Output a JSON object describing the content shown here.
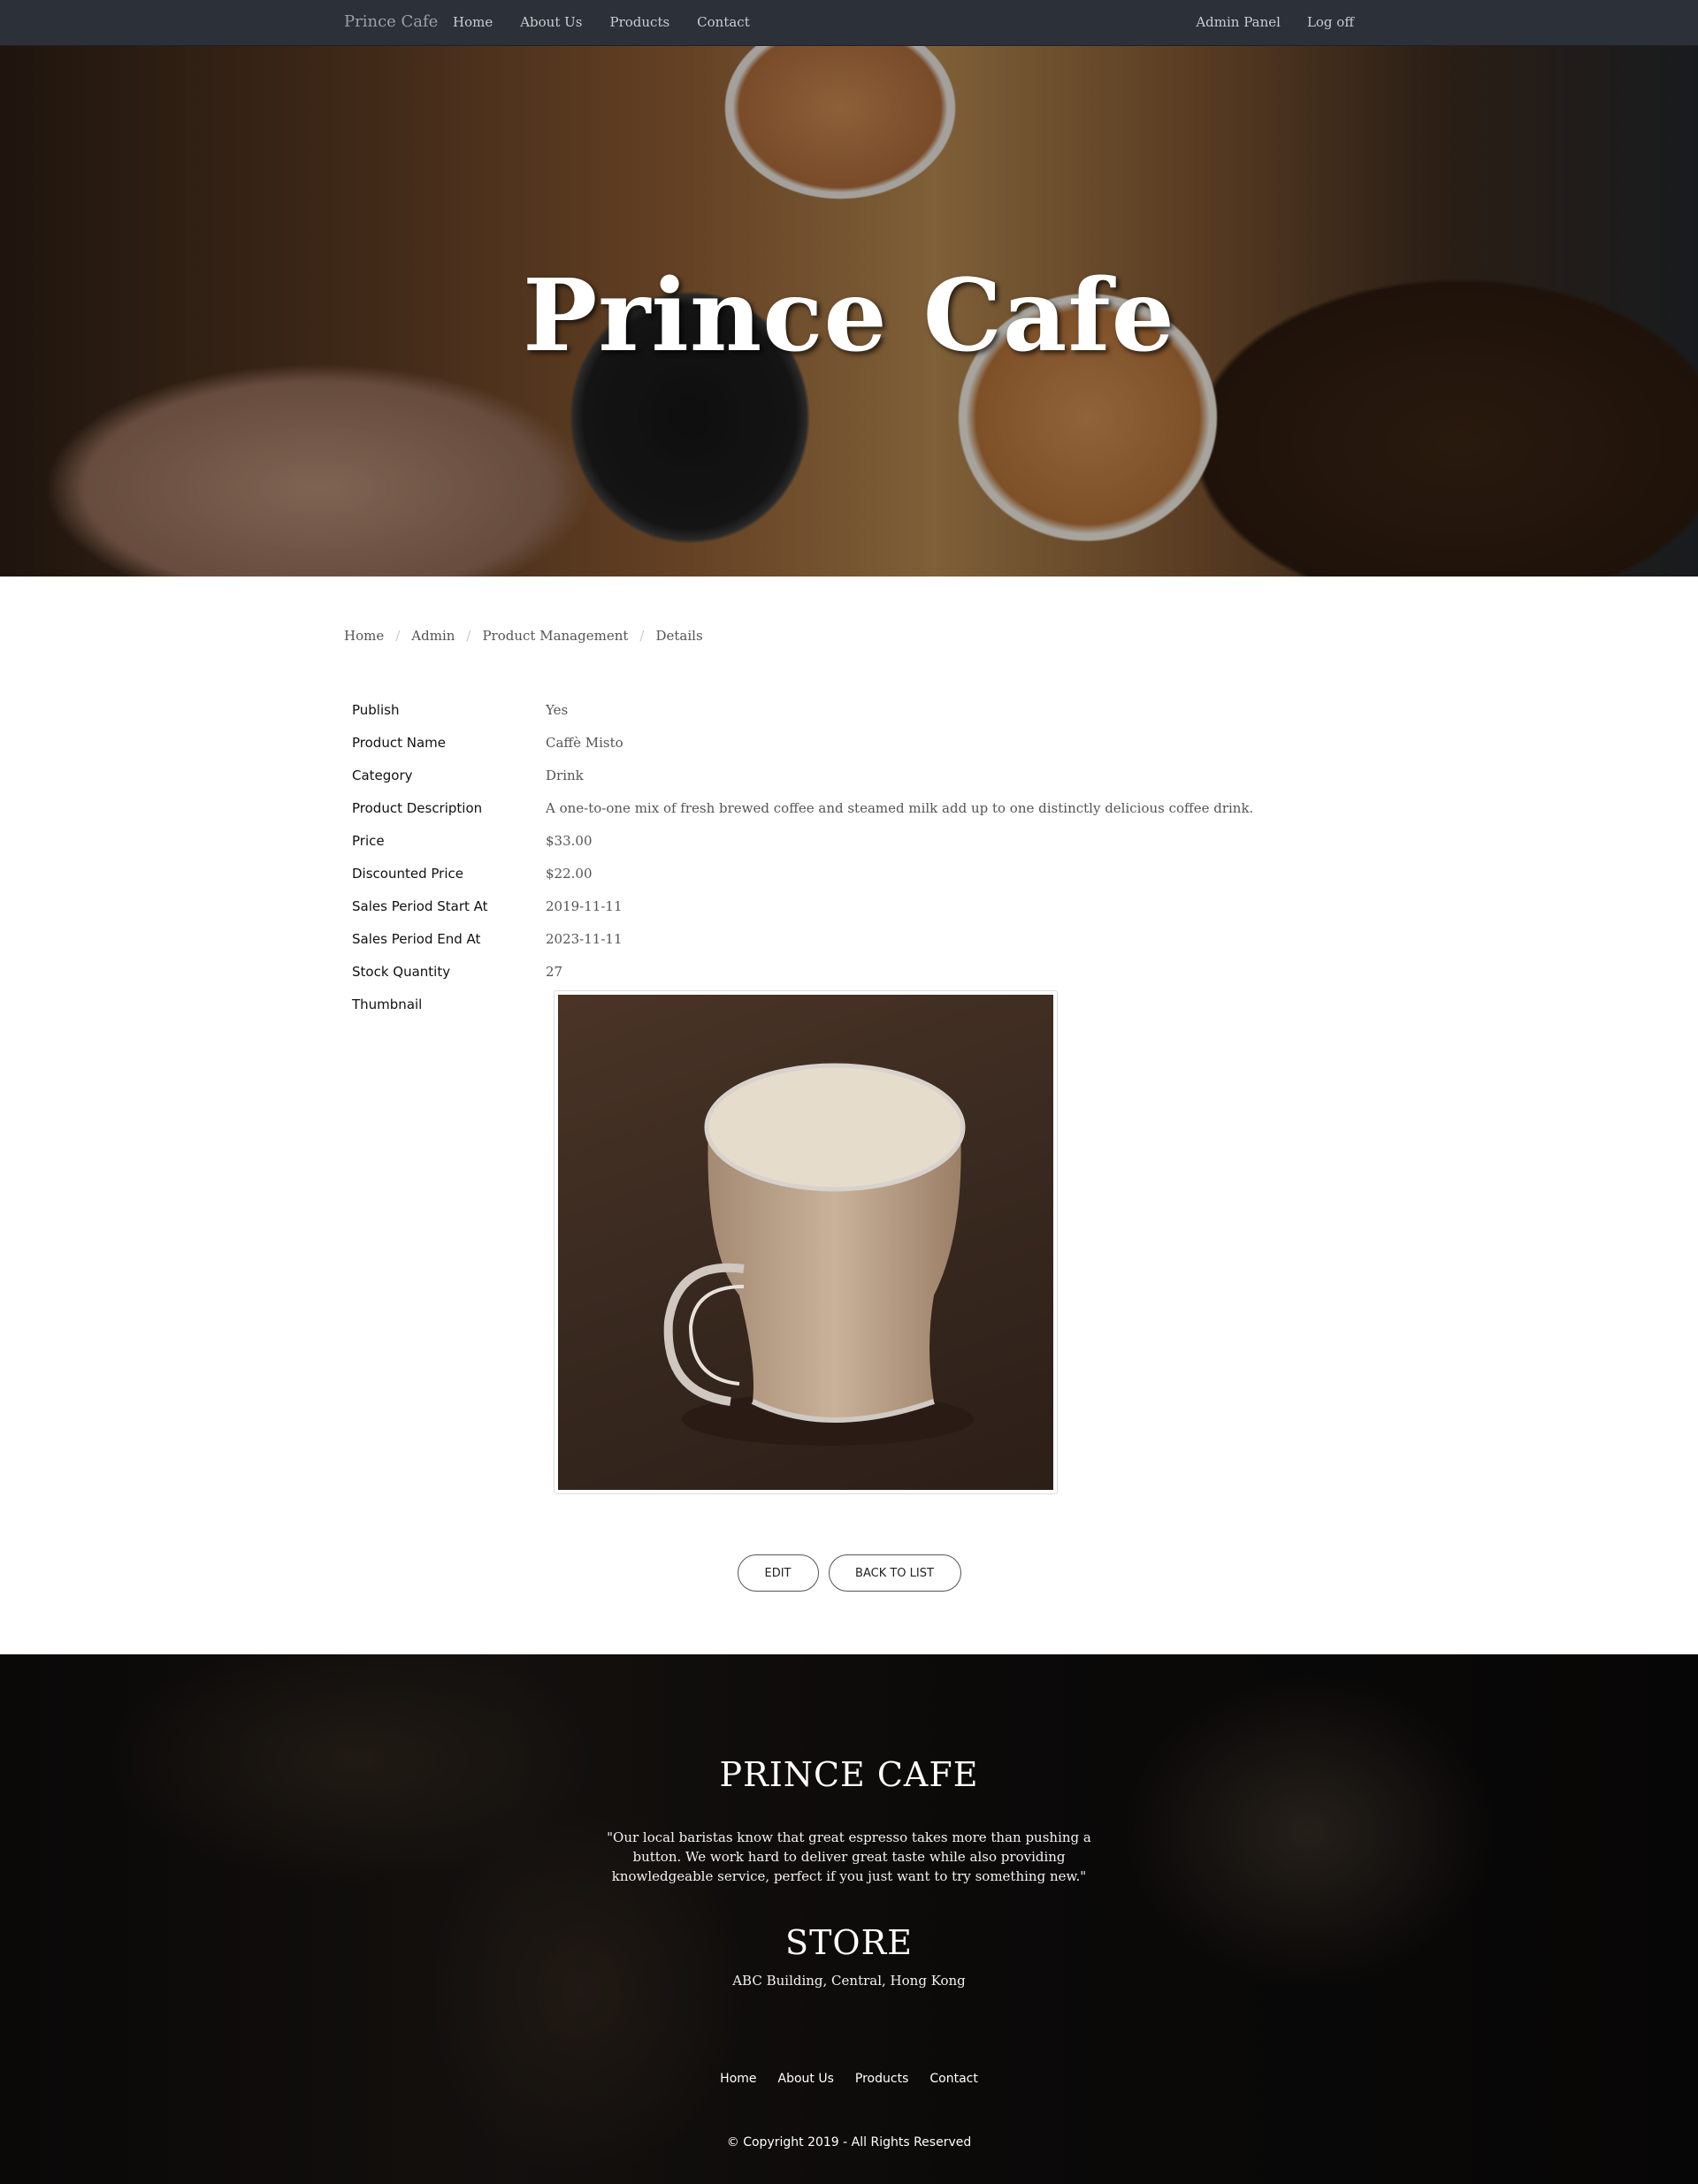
{
  "navbar": {
    "brand": "Prince Cafe",
    "links": [
      "Home",
      "About Us",
      "Products",
      "Contact"
    ],
    "right_links": [
      "Admin Panel",
      "Log off"
    ]
  },
  "hero": {
    "title": "Prince Cafe"
  },
  "breadcrumb": [
    "Home",
    "Admin",
    "Product Management",
    "Details"
  ],
  "details": [
    {
      "label": "Publish",
      "value": "Yes"
    },
    {
      "label": "Product Name",
      "value": "Caffè Misto"
    },
    {
      "label": "Category",
      "value": "Drink"
    },
    {
      "label": "Product Description",
      "value": "A one-to-one mix of fresh brewed coffee and steamed milk add up to one distinctly delicious coffee drink."
    },
    {
      "label": "Price",
      "value": "$33.00"
    },
    {
      "label": "Discounted Price",
      "value": "$22.00"
    },
    {
      "label": "Sales Period Start At",
      "value": "2019-11-11"
    },
    {
      "label": "Sales Period End At",
      "value": "2023-11-11"
    },
    {
      "label": "Stock Quantity",
      "value": "27"
    },
    {
      "label": "Thumbnail",
      "value": ""
    }
  ],
  "buttons": {
    "edit": "EDIT",
    "back": "BACK TO LIST"
  },
  "footer": {
    "title": "PRINCE CAFE",
    "quote": "\"Our local baristas know that great espresso takes more than pushing a button. We work hard to deliver great taste while also providing knowledgeable service, perfect if you just want to try something new.\"",
    "store_title": "STORE",
    "address": "ABC Building, Central, Hong Kong",
    "links": [
      "Home",
      "About Us",
      "Products",
      "Contact"
    ],
    "copyright": "© Copyright 2019 - All Rights Reserved"
  }
}
